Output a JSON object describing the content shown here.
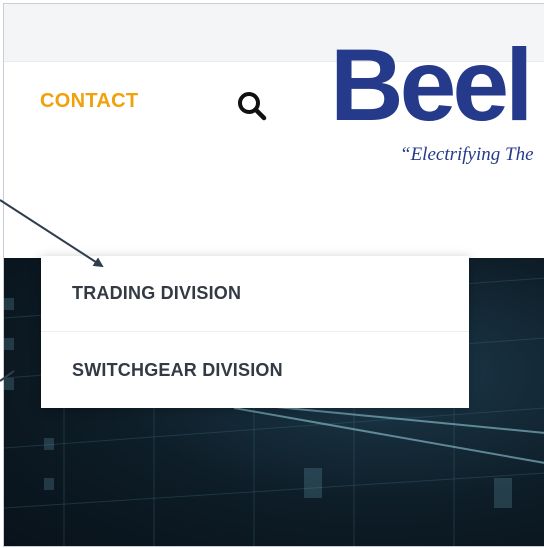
{
  "nav": {
    "contact_label": "CONTACT"
  },
  "search": {
    "icon": "search-icon"
  },
  "logo": {
    "wordmark": "Beel",
    "tagline": "“Electrifying The"
  },
  "dropdown": {
    "items": [
      {
        "label": "TRADING DIVISION"
      },
      {
        "label": "SWITCHGEAR DIVISION"
      }
    ]
  },
  "colors": {
    "nav_accent": "#f0a10c",
    "logo_blue": "#253a8a",
    "menu_text": "#333a44",
    "arrow": "#2f3d4f"
  }
}
